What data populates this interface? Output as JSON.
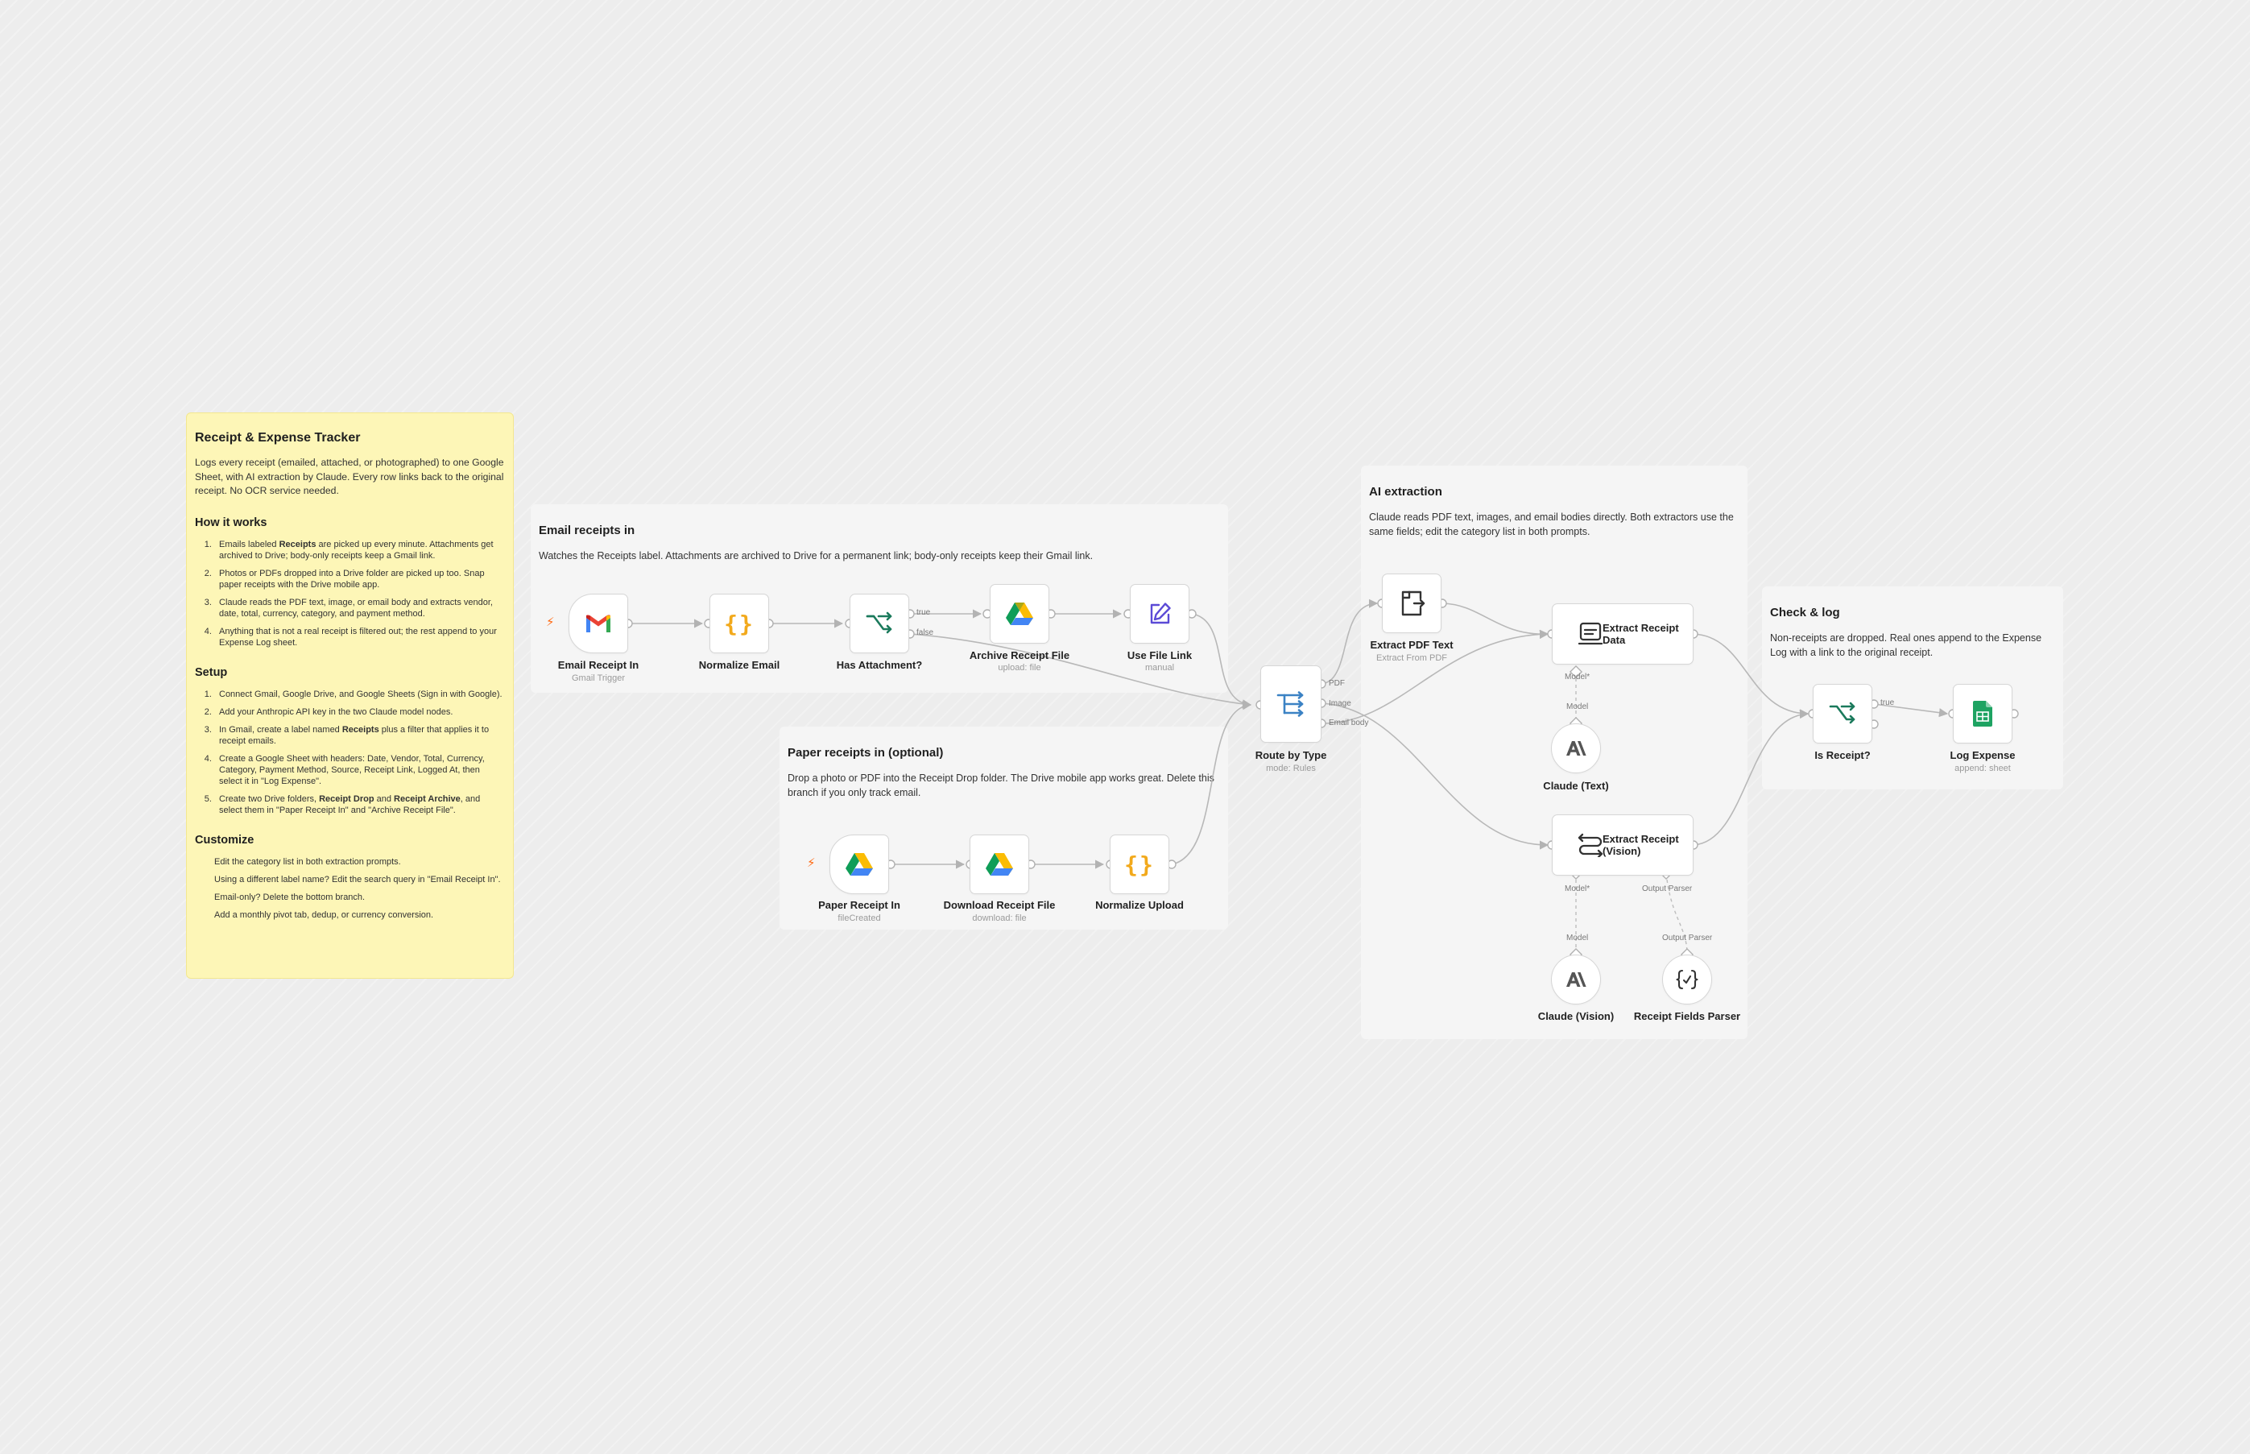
{
  "notes": {
    "email": {
      "title": "Email receipts in",
      "body": "Watches the Receipts label. Attachments are archived to Drive for a permanent link; body-only receipts keep their Gmail link."
    },
    "paper": {
      "title": "Paper receipts in (optional)",
      "body": "Drop a photo or PDF into the Receipt Drop folder. The Drive mobile app works great. Delete this branch if you only track email."
    },
    "ai": {
      "title": "AI extraction",
      "body": "Claude reads PDF text, images, and email bodies directly. Both extractors use the same fields; edit the category list in both prompts."
    },
    "check": {
      "title": "Check & log",
      "body": "Non-receipts are dropped. Real ones append to the Expense Log with a link to the original receipt."
    }
  },
  "sticky": {
    "title": "Receipt & Expense Tracker",
    "intro": "Logs every receipt (emailed, attached, or photographed) to one Google Sheet, with AI extraction by Claude. Every row links back to the original receipt. No OCR service needed.",
    "how_title": "How it works",
    "how": [
      {
        "pre": "Emails labeled ",
        "b": "Receipts",
        "post": " are picked up every minute. Attachments get archived to Drive; body-only receipts keep a Gmail link."
      },
      {
        "pre": "Photos or PDFs dropped into a Drive folder are picked up too. Snap paper receipts with the Drive mobile app.",
        "b": "",
        "post": ""
      },
      {
        "pre": "Claude reads the PDF text, image, or email body and extracts vendor, date, total, currency, category, and payment method.",
        "b": "",
        "post": ""
      },
      {
        "pre": "Anything that is not a real receipt is filtered out; the rest append to your Expense Log sheet.",
        "b": "",
        "post": ""
      }
    ],
    "setup_title": "Setup",
    "setup": [
      {
        "pre": "Connect Gmail, Google Drive, and Google Sheets (Sign in with Google).",
        "b": "",
        "mid": "",
        "b2": "",
        "post": ""
      },
      {
        "pre": "Add your Anthropic API key in the two Claude model nodes.",
        "b": "",
        "mid": "",
        "b2": "",
        "post": ""
      },
      {
        "pre": "In Gmail, create a label named ",
        "b": "Receipts",
        "mid": " plus a filter that applies it to receipt emails.",
        "b2": "",
        "post": ""
      },
      {
        "pre": "Create a Google Sheet with headers: Date, Vendor, Total, Currency, Category, Payment Method, Source, Receipt Link, Logged At, then select it in \"Log Expense\".",
        "b": "",
        "mid": "",
        "b2": "",
        "post": ""
      },
      {
        "pre": "Create two Drive folders, ",
        "b": "Receipt Drop",
        "mid": " and ",
        "b2": "Receipt Archive",
        "post": ", and select them in \"Paper Receipt In\" and \"Archive Receipt File\"."
      }
    ],
    "custom_title": "Customize",
    "custom": [
      "Edit the category list in both extraction prompts.",
      "Using a different label name? Edit the search query in \"Email Receipt In\".",
      "Email-only? Delete the bottom branch.",
      "Add a monthly pivot tab, dedup, or currency conversion."
    ]
  },
  "nodes": {
    "email_in": {
      "label": "Email Receipt In",
      "sub": "Gmail Trigger"
    },
    "normalize_email": {
      "label": "Normalize Email"
    },
    "has_attachment": {
      "label": "Has Attachment?",
      "true_port": "true",
      "false_port": "false"
    },
    "archive": {
      "label": "Archive Receipt File",
      "sub": "upload: file"
    },
    "use_link": {
      "label": "Use File Link",
      "sub": "manual"
    },
    "paper_in": {
      "label": "Paper Receipt In",
      "sub": "fileCreated"
    },
    "download": {
      "label": "Download Receipt File",
      "sub": "download: file"
    },
    "normalize_upload": {
      "label": "Normalize Upload"
    },
    "route": {
      "label": "Route by Type",
      "sub": "mode: Rules",
      "port_pdf": "PDF",
      "port_image": "Image",
      "port_email": "Email body"
    },
    "extract_pdf": {
      "label": "Extract PDF Text",
      "sub": "Extract From PDF"
    },
    "extract_data": {
      "label": "Extract Receipt Data",
      "port_model": "Model*"
    },
    "claude_text": {
      "label": "Claude (Text)",
      "port": "Model"
    },
    "extract_vision": {
      "label": "Extract Receipt (Vision)",
      "port_model": "Model*",
      "port_parser": "Output Parser"
    },
    "claude_vision": {
      "label": "Claude (Vision)",
      "port": "Model"
    },
    "parser": {
      "label": "Receipt Fields Parser",
      "port": "Output Parser"
    },
    "is_receipt": {
      "label": "Is Receipt?",
      "true_port": "true"
    },
    "log": {
      "label": "Log Expense",
      "sub": "append: sheet"
    }
  },
  "icons": {
    "trigger": "bolt-icon",
    "gmail": "gmail-icon",
    "code": "curly-braces-icon",
    "if": "if-branch-icon",
    "drive": "google-drive-icon",
    "edit": "pencil-edit-icon",
    "switch": "switch-route-icon",
    "pdf": "extract-file-icon",
    "llm": "llm-chain-icon",
    "info": "information-extractor-icon",
    "anthropic": "anthropic-icon",
    "parser": "structured-parser-icon",
    "sheets": "google-sheets-icon"
  },
  "colors": {
    "accent_orange": "#ff6a13",
    "sticky_yellow": "#fdf6b7",
    "if_teal": "#1b7a5c",
    "switch_blue": "#3b82c4",
    "edit_purple": "#5b4ad6",
    "sheets_green": "#1ea362"
  }
}
